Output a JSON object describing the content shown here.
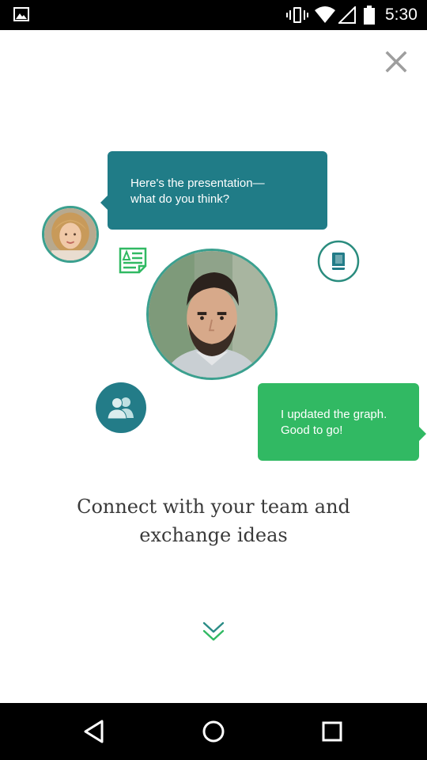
{
  "status_bar": {
    "time": "5:30",
    "icons": [
      "gallery-icon",
      "vibrate-icon",
      "wifi-icon",
      "signal-icon",
      "battery-icon"
    ]
  },
  "close": {
    "icon": "close-icon",
    "color": "#9e9e9e"
  },
  "illustration": {
    "bubble_teal": {
      "line1": "Here's the presentation—",
      "line2": "what do you think?",
      "color": "#207c87"
    },
    "bubble_green": {
      "line1": "I updated the graph.",
      "line2": "Good to go!",
      "color": "#31b963"
    },
    "icons": [
      "document-icon",
      "book-icon",
      "group-icon"
    ]
  },
  "headline": {
    "line1": "Connect with your team and",
    "line2": "exchange ideas"
  },
  "navigation": {
    "items": [
      "back-icon",
      "home-icon",
      "recent-apps-icon"
    ]
  },
  "colors": {
    "accent_teal": "#207c87",
    "accent_green": "#31b963",
    "ring": "#3ba08f"
  }
}
